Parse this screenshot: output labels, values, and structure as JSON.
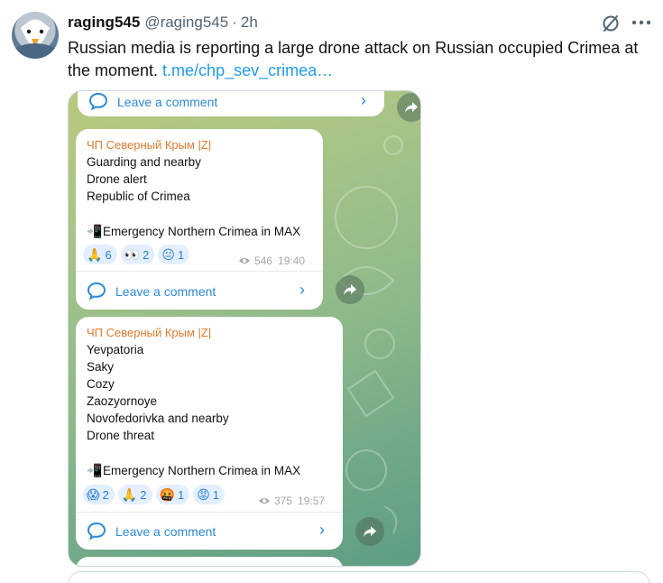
{
  "tweet": {
    "display_name": "raging545",
    "handle": "@raging545",
    "separator": "·",
    "time": "2h",
    "text": "Russian media is reporting a large drone attack on Russian occupied Crimea at the moment. ",
    "link": "t.me/chp_sev_crimea…"
  },
  "icons": {
    "grok": "grok-icon",
    "more": "more-icon"
  },
  "telegram": {
    "top_bubble": {
      "comment_label": "Leave a comment"
    },
    "messages": [
      {
        "sender": "ЧП Северный Крым |Z|",
        "lines": [
          "Guarding and nearby",
          "Drone alert",
          "Republic of Crimea"
        ],
        "footer_text": "Emergency Northern Crimea in MAX",
        "reactions": [
          {
            "emoji": "🙏",
            "count": "6"
          },
          {
            "emoji": "👀",
            "count": "2"
          },
          {
            "emoji": "😐",
            "count": "1"
          }
        ],
        "views": "546",
        "time": "19:40",
        "comment_label": "Leave a comment"
      },
      {
        "sender": "ЧП Северный Крым |Z|",
        "lines": [
          "Yevpatoria",
          "Saky",
          "Cozy",
          "Zaozyornoye",
          "Novofedorivka and nearby",
          "Drone threat"
        ],
        "footer_text": "Emergency Northern Crimea in MAX",
        "reactions": [
          {
            "emoji": "😱",
            "count": "2"
          },
          {
            "emoji": "🙏",
            "count": "2"
          },
          {
            "emoji": "🤬",
            "count": "1"
          },
          {
            "emoji": "😡",
            "count": "1"
          }
        ],
        "views": "375",
        "time": "19:57",
        "comment_label": "Leave a comment"
      }
    ]
  },
  "colors": {
    "link_blue": "#1d9bf0",
    "sender_orange": "#e27a2d",
    "telegram_blue": "#2b8ad8"
  }
}
